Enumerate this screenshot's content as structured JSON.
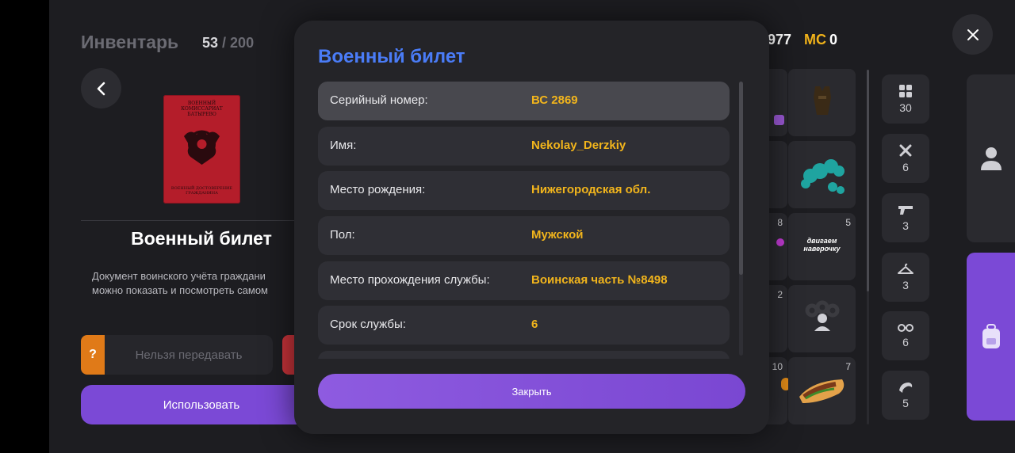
{
  "inventory": {
    "title": "Инвентарь",
    "count_current": "53",
    "count_sep": " / ",
    "count_max": "200",
    "passport_top_text": "ВОЕННЫЙ КОМИССАРИАТ БАТЫРЕВО",
    "passport_bottom_text": "ВОЕННЫЙ ДОСТОВЕРЕНИЕ ГРАЖДАНИНА",
    "item_name": "Военный билет",
    "item_desc_line1": "Документ воинского учёта граждани",
    "item_desc_line2": "можно показать и посмотреть самом",
    "question_mark": "?",
    "no_transfer_label": "Нельзя передавать",
    "use_button": "Использовать"
  },
  "header": {
    "money_partial": "977",
    "mc_label": "MC",
    "mc_value": "0"
  },
  "grid": {
    "qty_row3_left": "8",
    "qty_row3_right": "5",
    "qty_row4_left": "2",
    "qty_row5_left": "10",
    "qty_row5_right": "7",
    "banner_text": "двигаем наверочку"
  },
  "categories": [
    {
      "icon": "grid-icon",
      "count": "30"
    },
    {
      "icon": "tools-icon",
      "count": "6"
    },
    {
      "icon": "gun-icon",
      "count": "3"
    },
    {
      "icon": "hanger-icon",
      "count": "3"
    },
    {
      "icon": "glasses-icon",
      "count": "6"
    },
    {
      "icon": "hair-icon",
      "count": "5"
    }
  ],
  "modal": {
    "title": "Военный билет",
    "rows": [
      {
        "label": "Серийный номер:",
        "value": "ВС 2869"
      },
      {
        "label": "Имя:",
        "value": "Nekolay_Derzkiy"
      },
      {
        "label": "Место рождения:",
        "value": "Нижегородская обл."
      },
      {
        "label": "Пол:",
        "value": "Мужской"
      },
      {
        "label": "Место прохождения службы:",
        "value": "Воинская часть №8498"
      },
      {
        "label": "Срок службы:",
        "value": "6"
      }
    ],
    "close_button": "Закрыть"
  },
  "colors": {
    "accent_purple": "#7b49d6",
    "title_blue": "#4a7cf7",
    "value_yellow": "#f2b51c",
    "badge_orange": "#e07a18",
    "badge_red": "#c8333a"
  }
}
